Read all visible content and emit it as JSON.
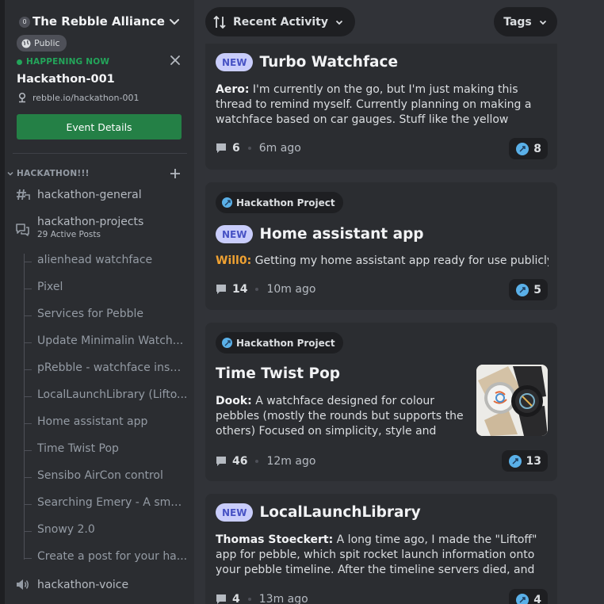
{
  "sidebar": {
    "server": {
      "badge": "0",
      "name": "The Rebble Alliance"
    },
    "public_label": "Public",
    "event": {
      "status": "HAPPENING NOW",
      "name": "Hackathon-001",
      "location": "rebble.io/hackathon-001",
      "button_label": "Event Details"
    },
    "category": "HACKATHON!!!",
    "channels": {
      "general": "hackathon-general",
      "projects": "hackathon-projects",
      "projects_sub": "29 Active Posts",
      "voice": "hackathon-voice"
    },
    "threads": [
      "alienhead watchface",
      "Pixel",
      "Services for Pebble",
      "Update Minimalin Watch...",
      "pRebble - watchface inspi...",
      "LocalLaunchLibrary (Lifto...",
      "Home assistant app",
      "Time Twist Pop",
      "Sensibo AirCon control",
      "Searching Emery - A smal...",
      "Snowy 2.0",
      "Create a post for your ha..."
    ]
  },
  "toolbar": {
    "sort_label": "Recent Activity",
    "tags_label": "Tags"
  },
  "posts": [
    {
      "new_label": "NEW",
      "title": "Turbo Watchface",
      "author": "Aero:",
      "body": "I'm currently on the go, but I'm just making this thread to remind myself. Currently planning on making a watchface based on car gauges. Stuff like the yellow Porsche Tachometer...",
      "comments": "6",
      "time": "6m ago",
      "reactions": "8"
    },
    {
      "tag": "Hackathon Project",
      "new_label": "NEW",
      "title": "Home assistant app",
      "author": "Will0:",
      "body": "Getting my home assistant app ready for use publicly",
      "comments": "14",
      "time": "10m ago",
      "reactions": "5"
    },
    {
      "tag": "Hackathon Project",
      "title": "Time Twist Pop",
      "author": "Dook:",
      "body": "A watchface designed for colour pebbles (mostly the rounds but supports the others) Focused on simplicity, style and colour options!",
      "comments": "46",
      "time": "12m ago",
      "reactions": "13"
    },
    {
      "new_label": "NEW",
      "title": "LocalLaunchLibrary",
      "author": "Thomas Stoeckert:",
      "body": "A long time ago, I made the \"Liftoff\" app for pebble, which spit rocket launch information onto your pebble timeline. After the timeline servers died, and by the time I got ...",
      "comments": "4",
      "time": "13m ago",
      "reactions": "4"
    }
  ],
  "colors": {
    "accent_green": "#248046",
    "status_green": "#23a55a",
    "new_badge": "#c9cdfb",
    "author_orange": "#f0a232"
  }
}
